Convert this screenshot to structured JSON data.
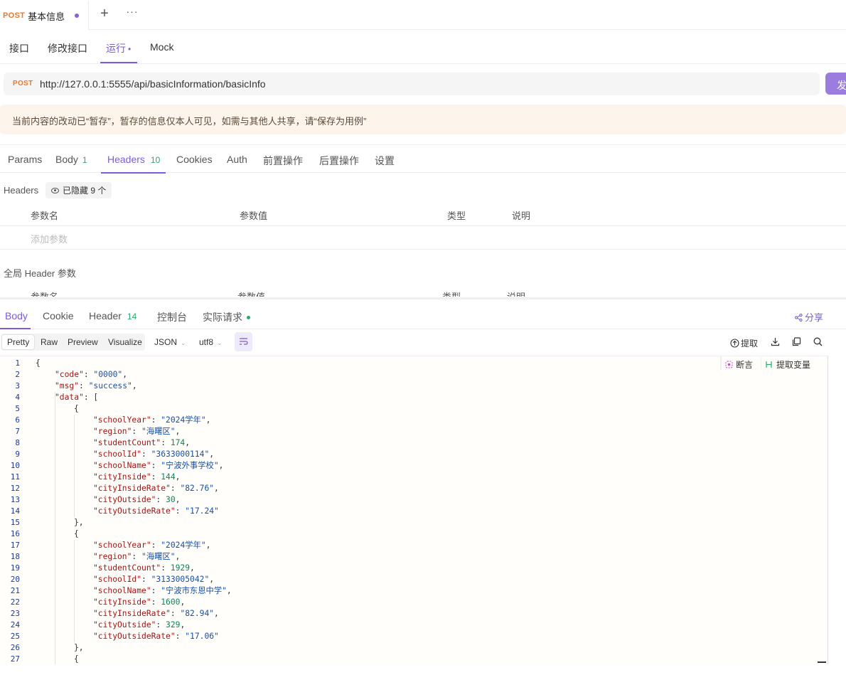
{
  "top_tab": {
    "method": "POST",
    "title": "基本信息"
  },
  "subtabs": [
    "接口",
    "修改接口",
    "运行",
    "Mock"
  ],
  "run_dot": "•",
  "request": {
    "method": "POST",
    "url": "http://127.0.0.1:5555/api/basicInformation/basicInfo",
    "send_label": "发"
  },
  "banner": "当前内容的改动已“暂存”，暂存的信息仅本人可见，如需与其他人共享，请“保存为用例”",
  "req_tabs": [
    {
      "label": "Params",
      "count": ""
    },
    {
      "label": "Body",
      "count": "1"
    },
    {
      "label": "Headers",
      "count": "10"
    },
    {
      "label": "Cookies",
      "count": ""
    },
    {
      "label": "Auth",
      "count": ""
    },
    {
      "label": "前置操作",
      "count": ""
    },
    {
      "label": "后置操作",
      "count": ""
    },
    {
      "label": "设置",
      "count": ""
    }
  ],
  "headers_section": {
    "label": "Headers",
    "hidden_chip": "已隐藏 9 个",
    "columns": [
      "参数名",
      "参数值",
      "类型",
      "说明"
    ],
    "add_placeholder": "添加参数"
  },
  "global_header": {
    "label": "全局 Header 参数",
    "columns": [
      "参数名",
      "参数值",
      "类型",
      "说明"
    ]
  },
  "resp_tabs": [
    {
      "label": "Body",
      "count": ""
    },
    {
      "label": "Cookie",
      "count": ""
    },
    {
      "label": "Header",
      "count": "14"
    },
    {
      "label": "控制台",
      "count": ""
    },
    {
      "label": "实际请求",
      "count": ""
    }
  ],
  "share_label": "分享",
  "formats": [
    "Pretty",
    "Raw",
    "Preview",
    "Visualize"
  ],
  "dropdowns": {
    "type": "JSON",
    "encoding": "utf8"
  },
  "tools": {
    "extract": "提取"
  },
  "editor_actions": {
    "assert": "断言",
    "extract_var": "提取变量"
  },
  "code_lines": [
    {
      "n": "1",
      "i": 0,
      "t": [
        [
          "p",
          "{"
        ]
      ]
    },
    {
      "n": "2",
      "i": 1,
      "t": [
        [
          "k",
          "\"code\""
        ],
        [
          "p",
          ": "
        ],
        [
          "s",
          "\"0000\""
        ],
        [
          "p",
          ","
        ]
      ]
    },
    {
      "n": "3",
      "i": 1,
      "t": [
        [
          "k",
          "\"msg\""
        ],
        [
          "p",
          ": "
        ],
        [
          "s",
          "\"success\""
        ],
        [
          "p",
          ","
        ]
      ]
    },
    {
      "n": "4",
      "i": 1,
      "t": [
        [
          "k",
          "\"data\""
        ],
        [
          "p",
          ": ["
        ]
      ]
    },
    {
      "n": "5",
      "i": 2,
      "t": [
        [
          "p",
          "{"
        ]
      ]
    },
    {
      "n": "6",
      "i": 3,
      "t": [
        [
          "k",
          "\"schoolYear\""
        ],
        [
          "p",
          ": "
        ],
        [
          "s",
          "\"2024学年\""
        ],
        [
          "p",
          ","
        ]
      ]
    },
    {
      "n": "7",
      "i": 3,
      "t": [
        [
          "k",
          "\"region\""
        ],
        [
          "p",
          ": "
        ],
        [
          "s",
          "\"海曙区\""
        ],
        [
          "p",
          ","
        ]
      ]
    },
    {
      "n": "8",
      "i": 3,
      "t": [
        [
          "k",
          "\"studentCount\""
        ],
        [
          "p",
          ": "
        ],
        [
          "n",
          "174"
        ],
        [
          "p",
          ","
        ]
      ]
    },
    {
      "n": "9",
      "i": 3,
      "t": [
        [
          "k",
          "\"schoolId\""
        ],
        [
          "p",
          ": "
        ],
        [
          "s",
          "\"3633000114\""
        ],
        [
          "p",
          ","
        ]
      ]
    },
    {
      "n": "10",
      "i": 3,
      "t": [
        [
          "k",
          "\"schoolName\""
        ],
        [
          "p",
          ": "
        ],
        [
          "s",
          "\"宁波外事学校\""
        ],
        [
          "p",
          ","
        ]
      ]
    },
    {
      "n": "11",
      "i": 3,
      "t": [
        [
          "k",
          "\"cityInside\""
        ],
        [
          "p",
          ": "
        ],
        [
          "n",
          "144"
        ],
        [
          "p",
          ","
        ]
      ]
    },
    {
      "n": "12",
      "i": 3,
      "t": [
        [
          "k",
          "\"cityInsideRate\""
        ],
        [
          "p",
          ": "
        ],
        [
          "s",
          "\"82.76\""
        ],
        [
          "p",
          ","
        ]
      ]
    },
    {
      "n": "13",
      "i": 3,
      "t": [
        [
          "k",
          "\"cityOutside\""
        ],
        [
          "p",
          ": "
        ],
        [
          "n",
          "30"
        ],
        [
          "p",
          ","
        ]
      ]
    },
    {
      "n": "14",
      "i": 3,
      "t": [
        [
          "k",
          "\"cityOutsideRate\""
        ],
        [
          "p",
          ": "
        ],
        [
          "s",
          "\"17.24\""
        ]
      ]
    },
    {
      "n": "15",
      "i": 2,
      "t": [
        [
          "p",
          "},"
        ]
      ]
    },
    {
      "n": "16",
      "i": 2,
      "t": [
        [
          "p",
          "{"
        ]
      ]
    },
    {
      "n": "17",
      "i": 3,
      "t": [
        [
          "k",
          "\"schoolYear\""
        ],
        [
          "p",
          ": "
        ],
        [
          "s",
          "\"2024学年\""
        ],
        [
          "p",
          ","
        ]
      ]
    },
    {
      "n": "18",
      "i": 3,
      "t": [
        [
          "k",
          "\"region\""
        ],
        [
          "p",
          ": "
        ],
        [
          "s",
          "\"海曙区\""
        ],
        [
          "p",
          ","
        ]
      ]
    },
    {
      "n": "19",
      "i": 3,
      "t": [
        [
          "k",
          "\"studentCount\""
        ],
        [
          "p",
          ": "
        ],
        [
          "n",
          "1929"
        ],
        [
          "p",
          ","
        ]
      ]
    },
    {
      "n": "20",
      "i": 3,
      "t": [
        [
          "k",
          "\"schoolId\""
        ],
        [
          "p",
          ": "
        ],
        [
          "s",
          "\"3133005042\""
        ],
        [
          "p",
          ","
        ]
      ]
    },
    {
      "n": "21",
      "i": 3,
      "t": [
        [
          "k",
          "\"schoolName\""
        ],
        [
          "p",
          ": "
        ],
        [
          "s",
          "\"宁波市东恩中学\""
        ],
        [
          "p",
          ","
        ]
      ]
    },
    {
      "n": "22",
      "i": 3,
      "t": [
        [
          "k",
          "\"cityInside\""
        ],
        [
          "p",
          ": "
        ],
        [
          "n",
          "1600"
        ],
        [
          "p",
          ","
        ]
      ]
    },
    {
      "n": "23",
      "i": 3,
      "t": [
        [
          "k",
          "\"cityInsideRate\""
        ],
        [
          "p",
          ": "
        ],
        [
          "s",
          "\"82.94\""
        ],
        [
          "p",
          ","
        ]
      ]
    },
    {
      "n": "24",
      "i": 3,
      "t": [
        [
          "k",
          "\"cityOutside\""
        ],
        [
          "p",
          ": "
        ],
        [
          "n",
          "329"
        ],
        [
          "p",
          ","
        ]
      ]
    },
    {
      "n": "25",
      "i": 3,
      "t": [
        [
          "k",
          "\"cityOutsideRate\""
        ],
        [
          "p",
          ": "
        ],
        [
          "s",
          "\"17.06\""
        ]
      ]
    },
    {
      "n": "26",
      "i": 2,
      "t": [
        [
          "p",
          "},"
        ]
      ]
    },
    {
      "n": "27",
      "i": 2,
      "t": [
        [
          "p",
          "{"
        ]
      ]
    }
  ],
  "colors": {
    "accent": "#7b5cd6",
    "post": "#e8772e",
    "count_green": "#29a96c",
    "banner_bg": "#fdf5ec"
  }
}
